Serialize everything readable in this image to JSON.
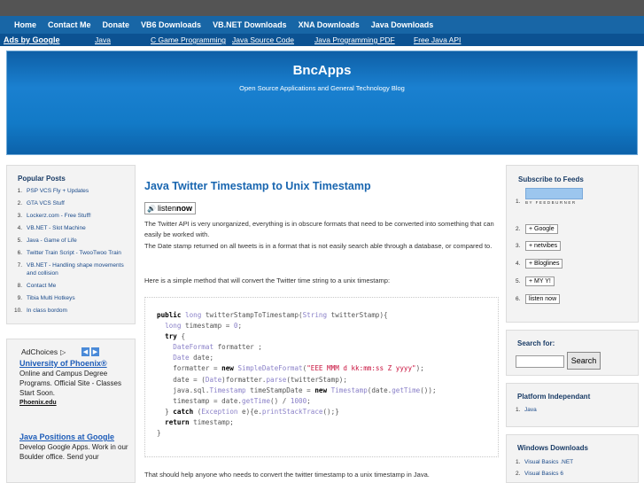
{
  "nav": [
    "Home",
    "Contact Me",
    "Donate",
    "VB6 Downloads",
    "VB.NET Downloads",
    "XNA Downloads",
    "Java Downloads"
  ],
  "ads_bar": {
    "label": "Ads by Google",
    "links": [
      "Java",
      "C Game Programming",
      "Java Source Code",
      "Java Programming PDF",
      "Free Java API"
    ]
  },
  "header": {
    "title": "BncApps",
    "tagline": "Open Source Applications and General Technology Blog"
  },
  "popular": {
    "title": "Popular Posts",
    "items": [
      {
        "n": "1.",
        "label": "PSP VCS Fly + Updates"
      },
      {
        "n": "2.",
        "label": "GTA VCS Stuff"
      },
      {
        "n": "3.",
        "label": "Lockerz.com - Free Stuff!"
      },
      {
        "n": "4.",
        "label": "VB.NET - Slot Machine"
      },
      {
        "n": "5.",
        "label": "Java - Game of Life"
      },
      {
        "n": "6.",
        "label": "Twitter Train Script - TwooTwoo Train"
      },
      {
        "n": "7.",
        "label": "VB.NET - Handling shape movements and collision"
      },
      {
        "n": "8.",
        "label": "Contact Me"
      },
      {
        "n": "9.",
        "label": "Tibia Multi Hotkeys"
      },
      {
        "n": "10.",
        "label": "In class bordom"
      }
    ]
  },
  "adbox": {
    "adchoices": "AdChoices",
    "ads": [
      {
        "headline": "University of Phoenix®",
        "body": "Online and Campus Degree Programs. Official Site - Classes Start Soon.",
        "url": "Phoenix.edu"
      },
      {
        "headline": "Java Positions at Google",
        "body": "Develop Google Apps. Work in our Boulder office. Send your",
        "url": ""
      }
    ]
  },
  "post": {
    "title": "Java Twitter Timestamp to Unix Timestamp",
    "listen_a": "listen ",
    "listen_b": "now",
    "p1": "The Twitter API is very unorganized, everything is in obscure formats that need to be converted into something that can easily be worked with.",
    "p2": "The Date stamp returned on all tweets is in a format that is not easily search able through a database, or compared to.",
    "p3": "Here is a simple method that will convert the Twitter time string to a unix timestamp:",
    "p4": "That should help anyone who needs to convert the twitter timestamp to a unix timestamp in Java."
  },
  "feeds": {
    "title": "Subscribe to Feeds",
    "feedburner": "BY FEEDBURNER",
    "buttons": [
      "+ Google",
      "+ netvibes",
      "+ Bloglines",
      "+ MY Y!",
      "listen now"
    ],
    "numbers": [
      "1.",
      "2.",
      "3.",
      "4.",
      "5.",
      "6."
    ]
  },
  "search": {
    "title": "Search for:",
    "button": "Search",
    "value": ""
  },
  "platform": {
    "title": "Platform Independant",
    "items": [
      {
        "n": "1.",
        "label": "Java"
      }
    ]
  },
  "windows": {
    "title": "Windows Downloads",
    "items": [
      {
        "n": "1.",
        "label": "Visual Basics .NET"
      },
      {
        "n": "2.",
        "label": "Visual Basics 6"
      }
    ]
  },
  "colors": {
    "nav": "#1866a6",
    "header": "#127ac7",
    "link": "#1966b0"
  }
}
